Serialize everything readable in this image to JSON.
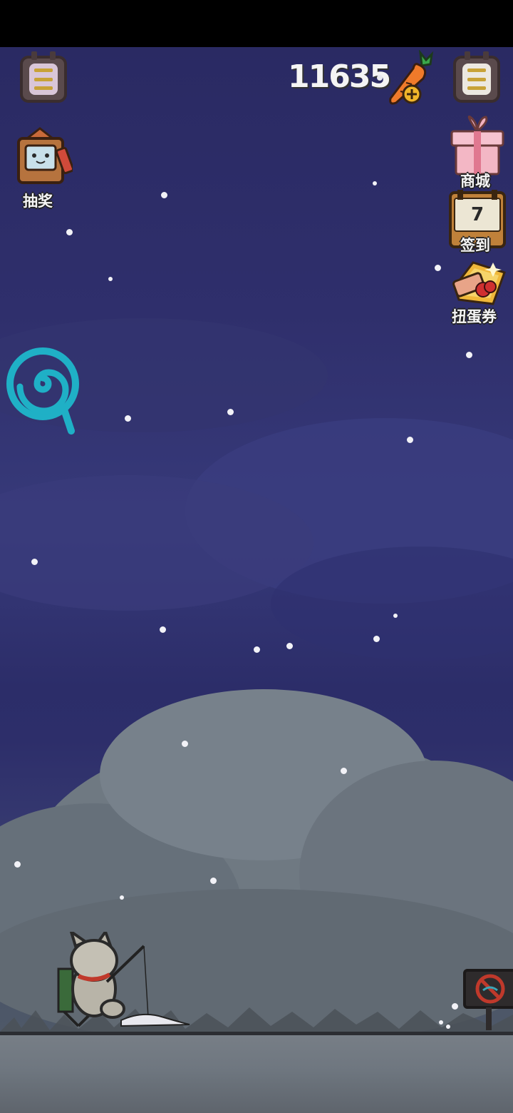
{
  "hud": {
    "coin_count": "11635",
    "left_menu_icon": "menu-icon",
    "right_menu_icon": "menu-icon",
    "add_carrot_icon": "carrot-plus-icon"
  },
  "left_actions": {
    "lottery": {
      "label": "抽奖",
      "icon": "lottery-box-icon"
    }
  },
  "right_actions": {
    "shop": {
      "label": "商城",
      "icon": "gift-box-icon"
    },
    "checkin": {
      "label": "签到",
      "day": "7",
      "icon": "calendar-icon"
    },
    "gacha_ticket": {
      "label": "扭蛋券",
      "icon": "gacha-ticket-icon"
    }
  },
  "floating": {
    "icon": "spiral-lollipop-icon"
  },
  "colors": {
    "sky_top": "#2a2a63",
    "sky_mid": "#373a7a",
    "cloud": "#76808a",
    "ground": "#737a82",
    "spiral": "#1fb0c6",
    "carrot": "#f07a2a"
  }
}
